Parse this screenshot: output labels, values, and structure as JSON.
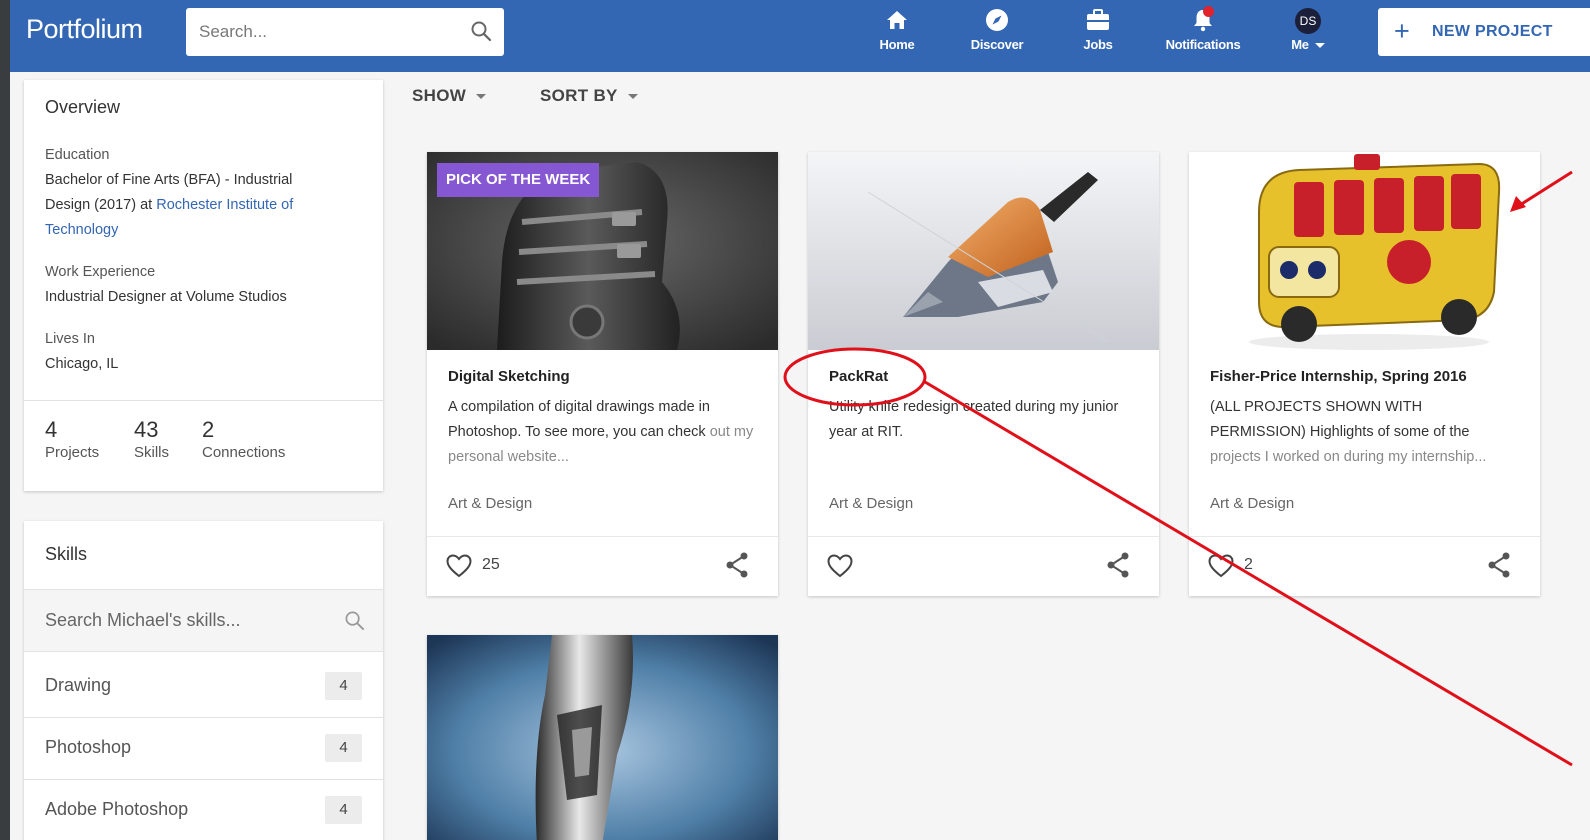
{
  "header": {
    "logo": "Portfolium",
    "search_placeholder": "Search...",
    "nav": {
      "home": "Home",
      "discover": "Discover",
      "jobs": "Jobs",
      "notifications": "Notifications",
      "me": "Me",
      "avatar_initials": "DS"
    },
    "new_project": "NEW PROJECT"
  },
  "overview": {
    "title": "Overview",
    "education_label": "Education",
    "education_text": "Bachelor of Fine Arts (BFA) - Industrial Design (2017) at ",
    "education_school": "Rochester Institute of Technology",
    "work_label": "Work Experience",
    "work_text": "Industrial Designer at Volume Studios",
    "lives_label": "Lives In",
    "lives_text": "Chicago, IL",
    "stats": [
      {
        "value": "4",
        "label": "Projects"
      },
      {
        "value": "43",
        "label": "Skills"
      },
      {
        "value": "2",
        "label": "Connections"
      }
    ]
  },
  "skills": {
    "title": "Skills",
    "search_placeholder": "Search Michael's skills...",
    "items": [
      {
        "name": "Drawing",
        "count": "4"
      },
      {
        "name": "Photoshop",
        "count": "4"
      },
      {
        "name": "Adobe Photoshop",
        "count": "4"
      }
    ]
  },
  "toolbar": {
    "show": "SHOW",
    "sort_by": "SORT BY"
  },
  "projects": [
    {
      "badge": "PICK OF THE WEEK",
      "title": "Digital Sketching",
      "desc_main": "A compilation of digital drawings made in Photoshop. To see more, you can check",
      "desc_faded": "out my personal website...",
      "category": "Art & Design",
      "likes": "25"
    },
    {
      "title": "PackRat",
      "desc_main": "Utility knife redesign created during my junior year at RIT.",
      "category": "Art & Design"
    },
    {
      "title": "Fisher-Price Internship, Spring 2016",
      "desc_main": "(ALL PROJECTS SHOWN WITH PERMISSION) Highlights of some of the",
      "desc_faded": "projects I worked on during my internship...",
      "category": "Art & Design",
      "likes": "2"
    }
  ],
  "colors": {
    "header_bg": "#3366b3",
    "badge_bg": "#8557d2",
    "annotation_red": "#e0101a",
    "notification_dot": "#e0222c"
  }
}
